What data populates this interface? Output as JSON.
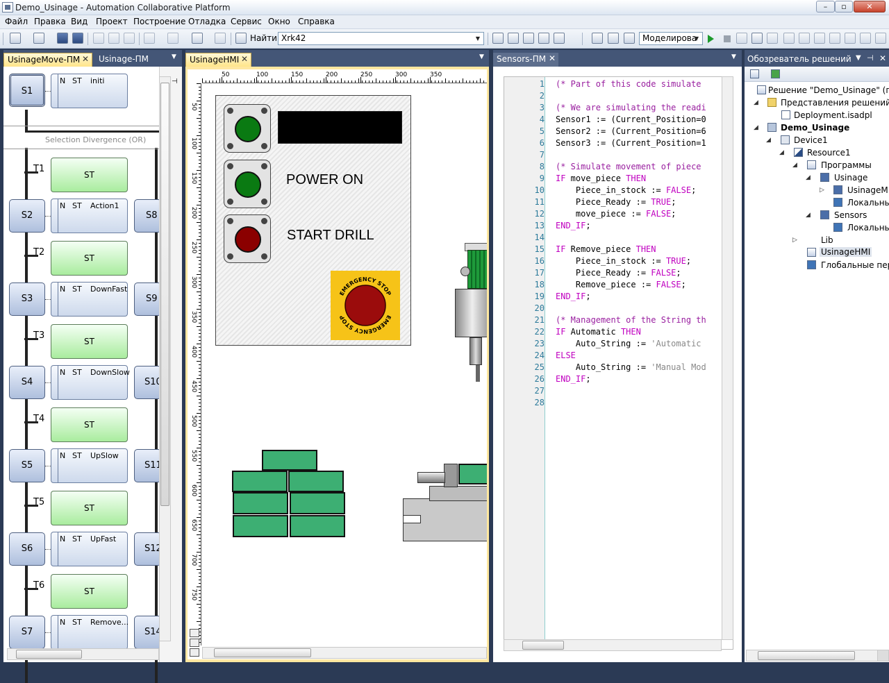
{
  "window": {
    "title": "Demo_Usinage - Automation Collaborative Platform",
    "min": "–",
    "max": "▫",
    "close": "✕"
  },
  "menu": [
    "Файл",
    "Правка",
    "Вид",
    "Проект",
    "Построение",
    "Отладка",
    "Сервис",
    "Окно",
    "Справка"
  ],
  "toolbar": {
    "find_label": "Найти",
    "find_value": "Xrk42",
    "mode_value": "Моделирова"
  },
  "tabs": {
    "left": [
      "UsinageMove-ПМ",
      "Usinage-ПМ"
    ],
    "hmi": "UsinageHMI",
    "code": "Sensors-ПМ",
    "explorer": "Обозреватель решений"
  },
  "sfc": {
    "init_step": "S1",
    "init_action": {
      "n": "N",
      "st": "ST",
      "name": "initi"
    },
    "divergence": "Selection Divergence (OR)",
    "rows": [
      {
        "t": "T1",
        "trans": "ST",
        "step": "S2",
        "n": "N",
        "st": "ST",
        "action": "Action1",
        "side": "S8"
      },
      {
        "t": "T2",
        "trans": "ST",
        "step": "S3",
        "n": "N",
        "st": "ST",
        "action": "DownFast",
        "side": "S9"
      },
      {
        "t": "T3",
        "trans": "ST",
        "step": "S4",
        "n": "N",
        "st": "ST",
        "action": "DownSlow",
        "side": "S10"
      },
      {
        "t": "T4",
        "trans": "ST",
        "step": "S5",
        "n": "N",
        "st": "ST",
        "action": "UpSlow",
        "side": "S11"
      },
      {
        "t": "T5",
        "trans": "ST",
        "step": "S6",
        "n": "N",
        "st": "ST",
        "action": "UpFast",
        "side": "S12"
      },
      {
        "t": "T6",
        "trans": "ST",
        "step": "S7",
        "n": "N",
        "st": "ST",
        "action": "Remove...",
        "side": "S14"
      }
    ]
  },
  "hmi": {
    "ruler_h": [
      "50",
      "100",
      "150",
      "200",
      "250",
      "300",
      "350"
    ],
    "ruler_v": [
      "50",
      "100",
      "150",
      "200",
      "250",
      "300",
      "350",
      "400",
      "450",
      "500",
      "550",
      "600",
      "650",
      "700",
      "750"
    ],
    "power_on": "POWER ON",
    "start_drill": "START DRILL",
    "estop_top": "EMERGENCY STOP",
    "estop_bottom": "EMERGENCY STOP",
    "colors": {
      "green_lamp": "#0a7a12",
      "red_lamp": "#8b0000",
      "estop_bg": "#f6c318",
      "box": "#3daf73",
      "motor": "#1e9a3a"
    }
  },
  "code": {
    "line_numbers": [
      "1",
      "2",
      "3",
      "4",
      "5",
      "6",
      "7",
      "8",
      "9",
      "10",
      "11",
      "12",
      "13",
      "14",
      "15",
      "16",
      "17",
      "18",
      "19",
      "20",
      "21",
      "22",
      "23",
      "24",
      "25",
      "26",
      "27",
      "28"
    ]
  },
  "explorer": {
    "items": [
      "Решение \"Demo_Usinage\" (пр",
      "Представления решений",
      "Deployment.isadpl",
      "Demo_Usinage",
      "Device1",
      "Resource1",
      "Программы",
      "Usinage",
      "UsinageM",
      "Локальнь",
      "Sensors",
      "Локальнь",
      "Lib",
      "UsinageHMI",
      "Глобальные пер"
    ]
  }
}
